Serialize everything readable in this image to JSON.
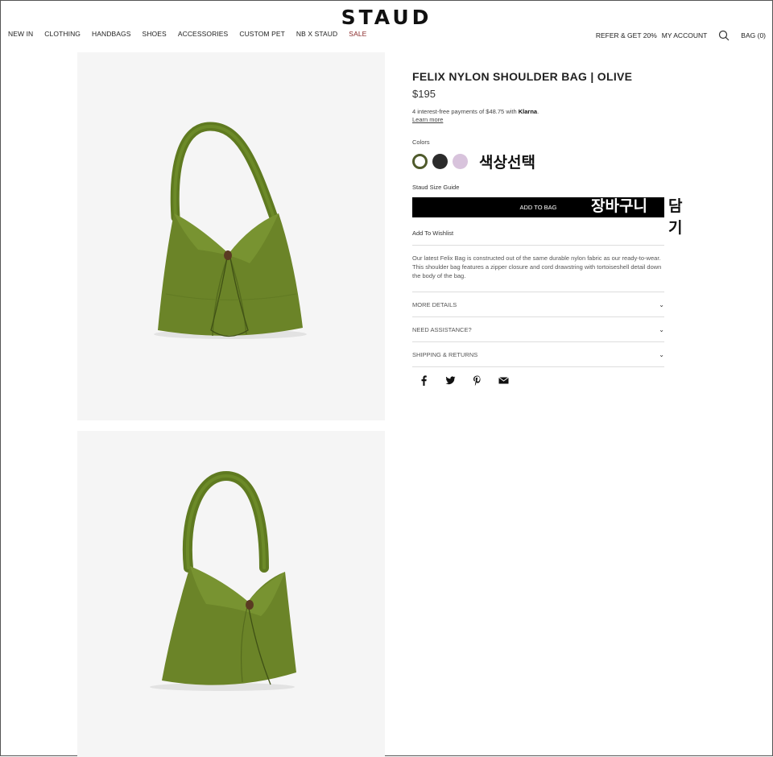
{
  "header": {
    "logo": "STAUD",
    "nav": [
      "NEW IN",
      "CLOTHING",
      "HANDBAGS",
      "SHOES",
      "ACCESSORIES",
      "CUSTOM PET",
      "NB X STAUD",
      "SALE"
    ],
    "refer": "REFER & GET 20%",
    "account": "MY ACCOUNT",
    "bag": "BAG (0)"
  },
  "product": {
    "title": "FELIX NYLON SHOULDER BAG | OLIVE",
    "price": "$195",
    "klarna_text": "4 interest-free payments of $48.75 with",
    "klarna_brand": "Klarna",
    "learn_more": "Learn more",
    "colors_label": "Colors",
    "colors": [
      "#4f5a2b",
      "#2b2b2b",
      "#d8c3dc"
    ],
    "size_guide": "Staud Size Guide",
    "add_to_bag": "ADD TO BAG",
    "wishlist": "Add To Wishlist",
    "description": "Our latest Felix Bag is constructed out of the same durable nylon fabric as our ready-to-wear. This shoulder bag features a zipper closure and cord drawstring with tortoiseshell detail down the body of the bag.",
    "accordion": [
      "MORE DETAILS",
      "NEED ASSISTANCE?",
      "SHIPPING & RETURNS"
    ]
  },
  "annotations": {
    "color_select": "색상선택",
    "cart_part1": "장바구니",
    "cart_part2": "담기"
  },
  "icons": [
    "search-icon",
    "facebook-icon",
    "twitter-icon",
    "pinterest-icon",
    "email-icon",
    "chevron-down-icon"
  ]
}
